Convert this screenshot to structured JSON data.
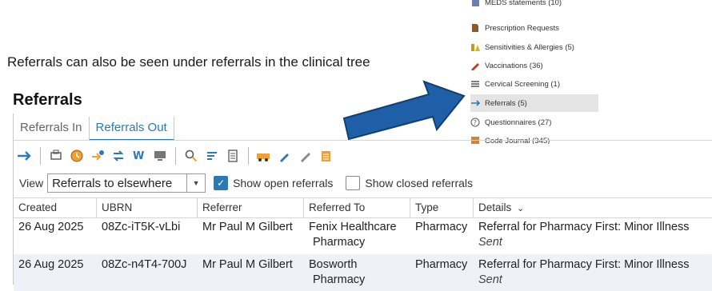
{
  "clinical_tree": {
    "items": [
      {
        "label": "MEDS statements (10)",
        "icon": "meds-icon"
      },
      {
        "label": "Prescription Requests",
        "icon": "prescription-icon"
      },
      {
        "label": "Sensitivities & Allergies (5)",
        "icon": "allergy-icon"
      },
      {
        "label": "Vaccinations (36)",
        "icon": "vaccination-icon"
      },
      {
        "label": "Cervical Screening (1)",
        "icon": "screening-icon"
      },
      {
        "label": "Referrals (5)",
        "icon": "arrow-right-icon",
        "selected": true
      },
      {
        "label": "Questionnaires (27)",
        "icon": "question-icon"
      },
      {
        "label": "Code Journal (345)",
        "icon": "journal-icon"
      }
    ]
  },
  "caption": "Referrals can also be seen under referrals in the clinical tree",
  "panel": {
    "title": "Referrals",
    "tabs": [
      {
        "label": "Referrals In",
        "active": false
      },
      {
        "label": "Referrals Out",
        "active": true
      }
    ],
    "view_label": "View",
    "view_value": "Referrals to elsewhere",
    "show_open": {
      "label": "Show open referrals",
      "checked": true
    },
    "show_closed": {
      "label": "Show closed referrals",
      "checked": false
    },
    "columns": [
      "Created",
      "UBRN",
      "Referrer",
      "Referred To",
      "Type",
      "Details"
    ],
    "rows": [
      {
        "created": "26 Aug 2025",
        "ubrn": "08Zc-iT5K-vLbi",
        "referrer": "Mr Paul M Gilbert",
        "referred_to_1": "Fenix Healthcare",
        "referred_to_2": "Pharmacy",
        "type": "Pharmacy",
        "details": "Referral for Pharmacy First: Minor Illness",
        "status": "Sent"
      },
      {
        "created": "26 Aug 2025",
        "ubrn": "08Zc-n4T4-700J",
        "referrer": "Mr Paul M Gilbert",
        "referred_to_1": "Bosworth",
        "referred_to_2": "Pharmacy",
        "type": "Pharmacy",
        "details": "Referral for Pharmacy First: Minor Illness",
        "status": "Sent"
      }
    ]
  },
  "colors": {
    "accent": "#2a7ab8",
    "arrow": "#1f5fa8",
    "selected_bg": "#e4e4e4",
    "alt_row": "#eef2f8"
  }
}
